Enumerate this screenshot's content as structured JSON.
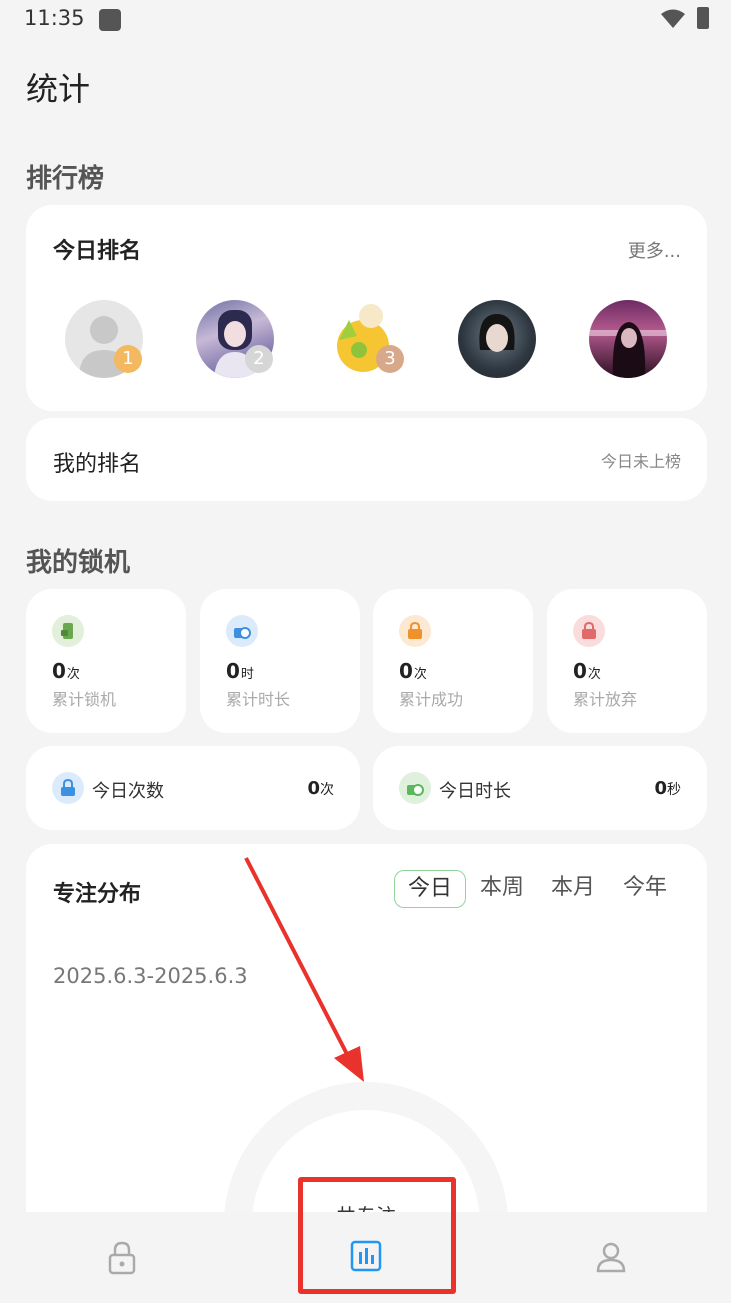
{
  "status_bar": {
    "time": "11:35",
    "icons": [
      "app-icon",
      "wifi-icon",
      "battery-icon"
    ]
  },
  "page": {
    "title": "统计"
  },
  "leaderboard": {
    "section_title": "排行榜",
    "today_title": "今日排名",
    "more": "更多...",
    "avatars": [
      {
        "rank": "1",
        "badge_color": "#f4b860"
      },
      {
        "rank": "2",
        "badge_color": "#c8c8c8"
      },
      {
        "rank": "3",
        "badge_color": "#d7a98a"
      },
      {
        "rank": ""
      },
      {
        "rank": ""
      }
    ],
    "my_rank_label": "我的排名",
    "my_rank_status": "今日未上榜"
  },
  "my_lock": {
    "section_title": "我的锁机",
    "stats": [
      {
        "value": "0",
        "unit": "次",
        "label": "累计锁机",
        "icon": "phone-lock-icon",
        "color": "#6aa84f"
      },
      {
        "value": "0",
        "unit": "时",
        "label": "累计时长",
        "icon": "clock-lock-icon",
        "color": "#3d8fe0"
      },
      {
        "value": "0",
        "unit": "次",
        "label": "累计成功",
        "icon": "lock-check-icon",
        "color": "#f0922b"
      },
      {
        "value": "0",
        "unit": "次",
        "label": "累计放弃",
        "icon": "lock-x-icon",
        "color": "#e06a6a"
      }
    ],
    "today": [
      {
        "label": "今日次数",
        "value": "0",
        "unit": "次",
        "icon": "lock-icon",
        "color": "#3d8fe0"
      },
      {
        "label": "今日时长",
        "value": "0",
        "unit": "秒",
        "icon": "clock-lock-icon",
        "color": "#5cb85c"
      }
    ]
  },
  "focus": {
    "title": "专注分布",
    "tabs": [
      "今日",
      "本周",
      "本月",
      "今年"
    ],
    "active_tab": "今日",
    "date_range": "2025.6.3-2025.6.3",
    "donut_label": "共专注"
  },
  "bottom_nav": {
    "items": [
      "lock-tab",
      "stats-tab",
      "profile-tab"
    ],
    "active": "stats-tab",
    "accent": "#2196f3"
  },
  "annotation": {
    "arrow_color": "#e8322b"
  }
}
